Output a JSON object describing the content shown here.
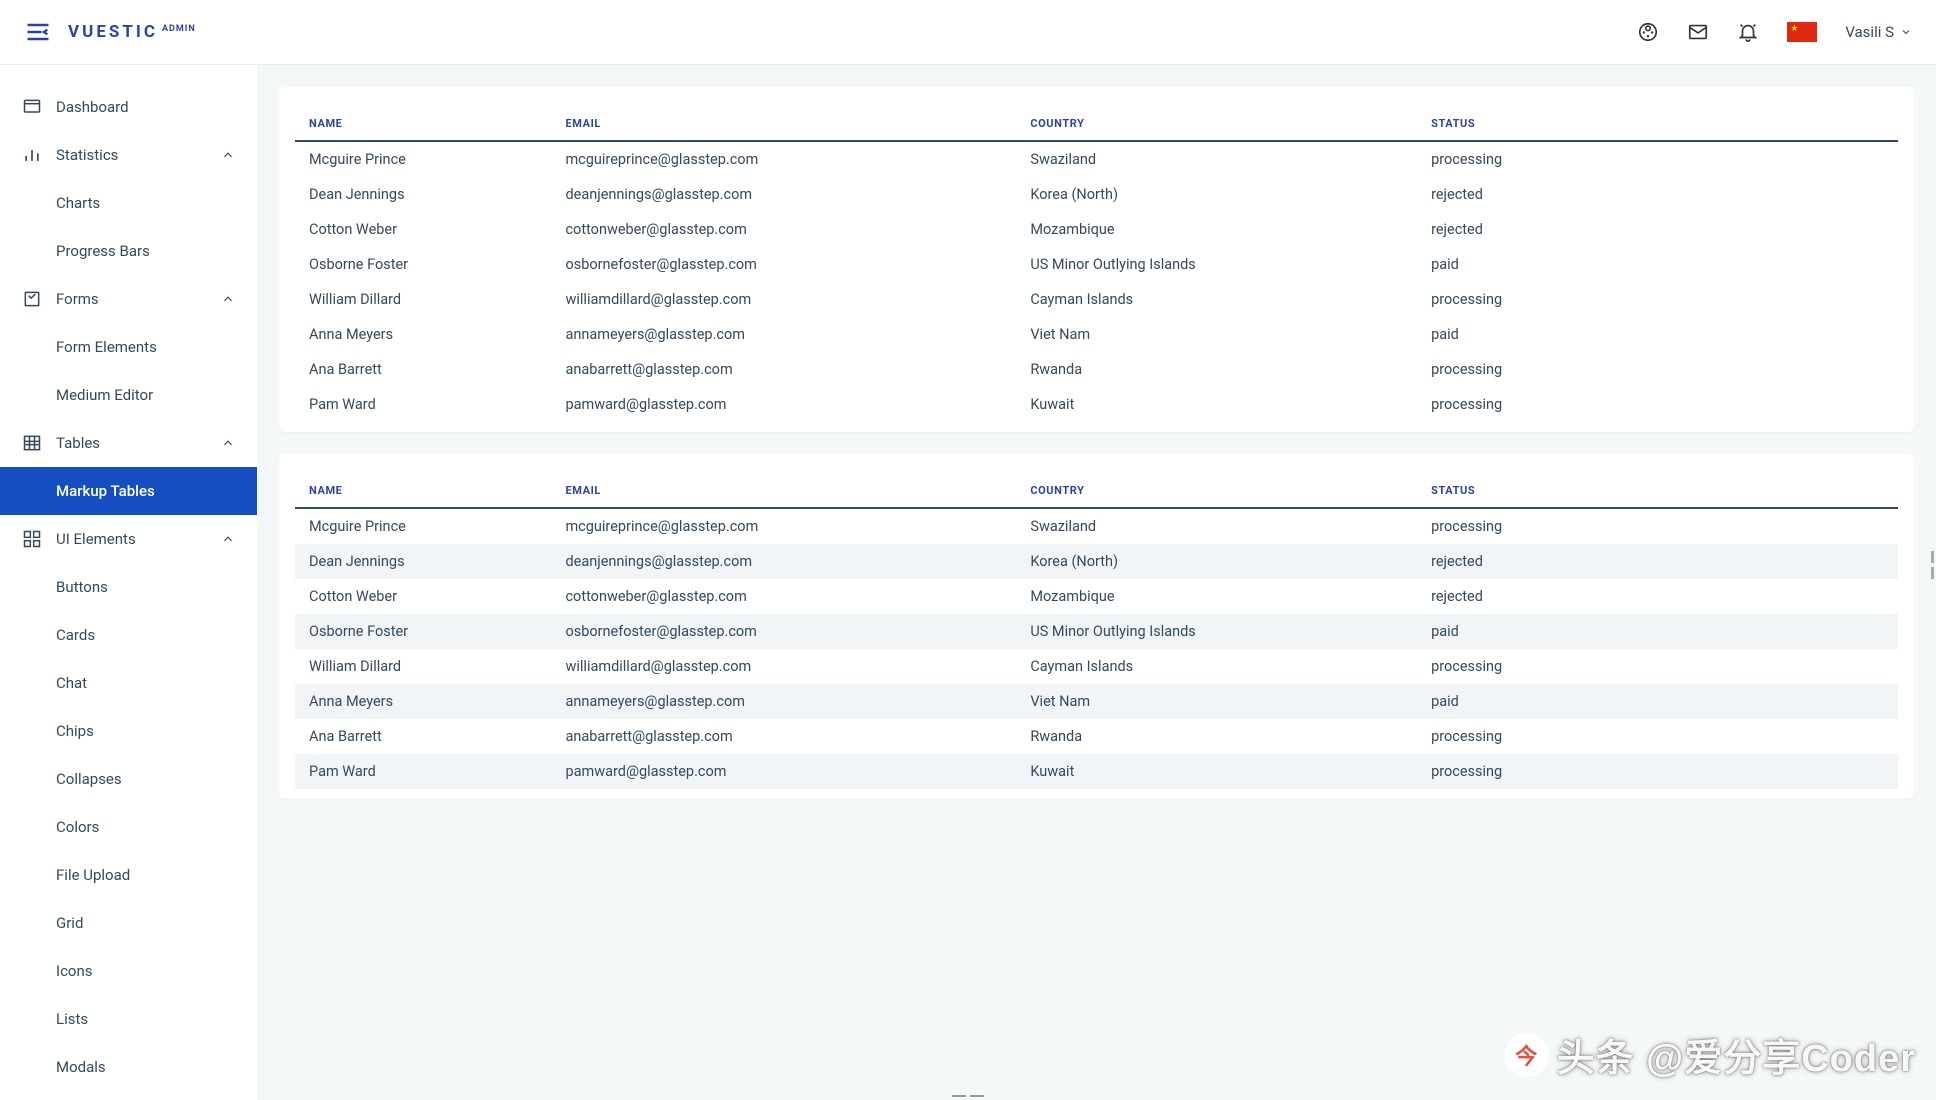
{
  "header": {
    "logo_main": "VUESTIC",
    "logo_admin": "ADMIN",
    "user_name": "Vasili S"
  },
  "sidebar": {
    "dashboard": "Dashboard",
    "statistics": "Statistics",
    "charts": "Charts",
    "progress_bars": "Progress Bars",
    "forms": "Forms",
    "form_elements": "Form Elements",
    "medium_editor": "Medium Editor",
    "tables": "Tables",
    "markup_tables": "Markup Tables",
    "ui_elements": "UI Elements",
    "buttons": "Buttons",
    "cards": "Cards",
    "chat": "Chat",
    "chips": "Chips",
    "collapses": "Collapses",
    "colors": "Colors",
    "file_upload": "File Upload",
    "grid": "Grid",
    "icons": "Icons",
    "lists": "Lists",
    "modals": "Modals"
  },
  "table": {
    "headers": {
      "name": "NAME",
      "email": "EMAIL",
      "country": "COUNTRY",
      "status": "STATUS"
    },
    "rows": [
      {
        "name": "Mcguire Prince",
        "email": "mcguireprince@glasstep.com",
        "country": "Swaziland",
        "status": "processing"
      },
      {
        "name": "Dean Jennings",
        "email": "deanjennings@glasstep.com",
        "country": "Korea (North)",
        "status": "rejected"
      },
      {
        "name": "Cotton Weber",
        "email": "cottonweber@glasstep.com",
        "country": "Mozambique",
        "status": "rejected"
      },
      {
        "name": "Osborne Foster",
        "email": "osbornefoster@glasstep.com",
        "country": "US Minor Outlying Islands",
        "status": "paid"
      },
      {
        "name": "William Dillard",
        "email": "williamdillard@glasstep.com",
        "country": "Cayman Islands",
        "status": "processing"
      },
      {
        "name": "Anna Meyers",
        "email": "annameyers@glasstep.com",
        "country": "Viet Nam",
        "status": "paid"
      },
      {
        "name": "Ana Barrett",
        "email": "anabarrett@glasstep.com",
        "country": "Rwanda",
        "status": "processing"
      },
      {
        "name": "Pam Ward",
        "email": "pamward@glasstep.com",
        "country": "Kuwait",
        "status": "processing"
      }
    ]
  },
  "watermark": "头条 @爱分享Coder"
}
